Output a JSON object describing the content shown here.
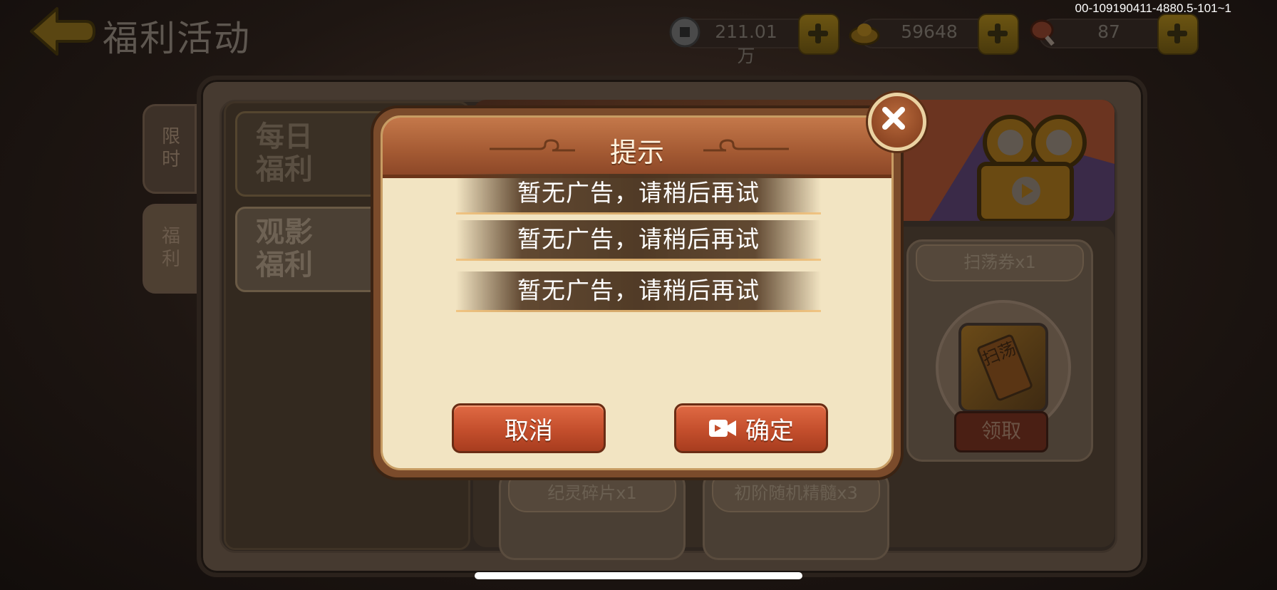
{
  "header": {
    "title": "福利活动",
    "build_id": "00-109190411-4880.5-101~1"
  },
  "resources": [
    {
      "icon": "copper-coin-icon",
      "value": "211.01万"
    },
    {
      "icon": "gold-ingot-icon",
      "value": "59648"
    },
    {
      "icon": "meat-stamina-icon",
      "value": "87"
    }
  ],
  "side_tabs": [
    {
      "label": "限时"
    },
    {
      "label": "福利"
    }
  ],
  "categories": [
    {
      "label_line1": "每日",
      "label_line2": "福利"
    },
    {
      "label_line1": "观影",
      "label_line2": "福利"
    }
  ],
  "reward_cards": [
    {
      "title": "扫荡券x1",
      "item_text": "扫荡",
      "button": "领取"
    },
    {
      "title": "纪灵碎片x1"
    },
    {
      "title": "初阶随机精髓x3"
    }
  ],
  "dialog": {
    "title": "提示",
    "messages": [
      "暂无广告，请稍后再试",
      "暂无广告，请稍后再试",
      "暂无广告，请稍后再试"
    ],
    "cancel_label": "取消",
    "confirm_label": "确定"
  },
  "colors": {
    "dialog_header": "#a45a33",
    "dialog_body": "#f2e4c2",
    "button_red": "#c34e2c",
    "toast_text": "#ffffff"
  }
}
